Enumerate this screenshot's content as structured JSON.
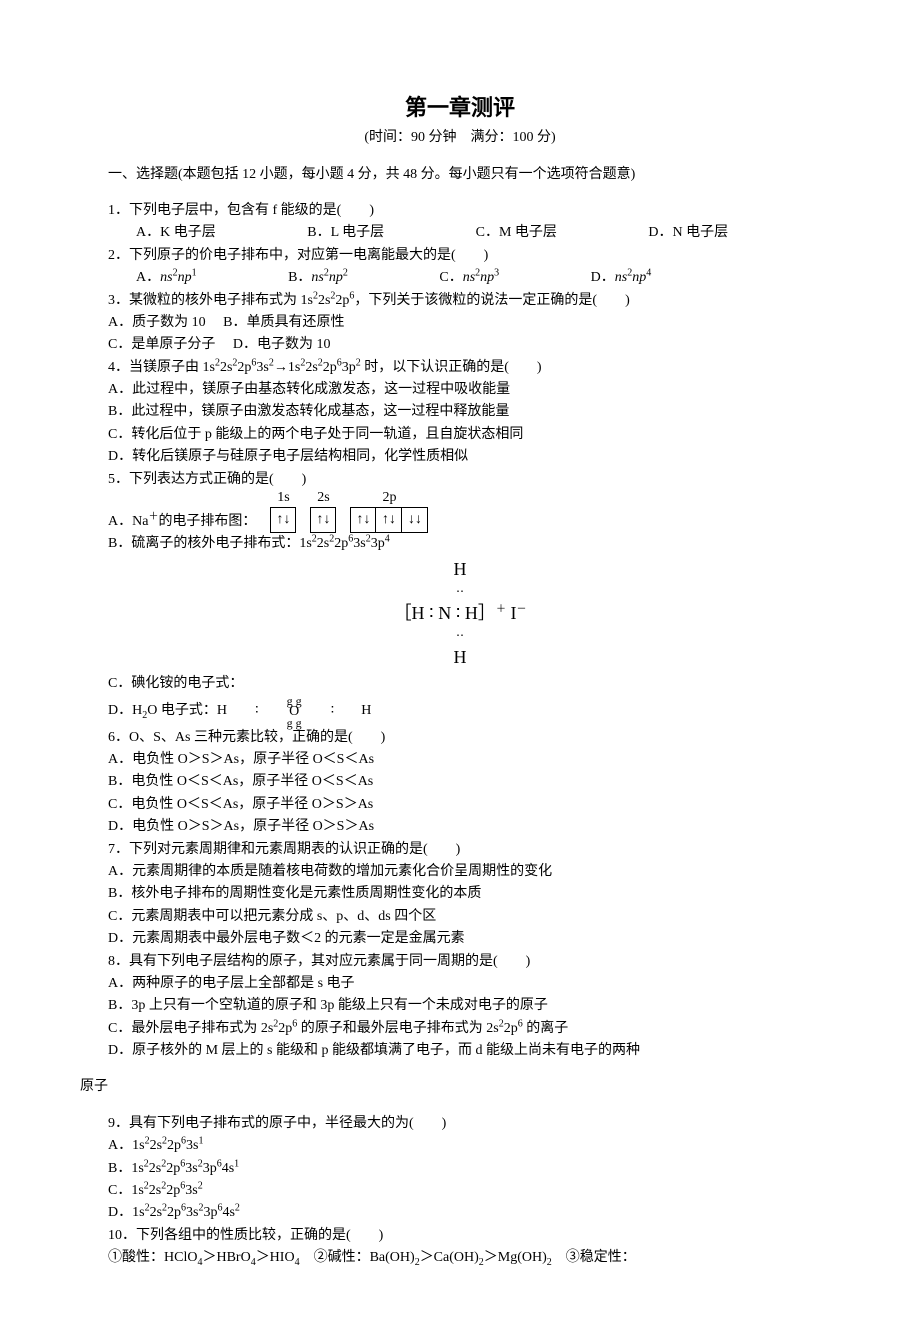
{
  "title": "第一章测评",
  "subtitle": "(时间：90 分钟　满分：100 分)",
  "section1_header": "一、选择题(本题包括 12 小题，每小题 4 分，共 48 分。每小题只有一个选项符合题意)",
  "q1": {
    "stem": "1．下列电子层中，包含有 f 能级的是(　　)",
    "A": "A．K 电子层",
    "B": "B．L 电子层",
    "C": "C．M 电子层",
    "D": "D．N 电子层"
  },
  "q2": {
    "stem": "2．下列原子的价电子排布中，对应第一电离能最大的是(　　)",
    "A_pre": "A．",
    "A_cfg": "ns",
    "A_sup1": "2",
    "A_mid": "np",
    "A_sup2": "1",
    "B_pre": "B．",
    "B_cfg": "ns",
    "B_sup1": "2",
    "B_mid": "np",
    "B_sup2": "2",
    "C_pre": "C．",
    "C_cfg": "ns",
    "C_sup1": "2",
    "C_mid": "np",
    "C_sup2": "3",
    "D_pre": "D．",
    "D_cfg": "ns",
    "D_sup1": "2",
    "D_mid": "np",
    "D_sup2": "4"
  },
  "q3": {
    "stem_pre": "3．某微粒的核外电子排布式为 1s",
    "stem_post": "，下列关于该微粒的说法一定正确的是(　　)",
    "cfg": [
      "2",
      "2s",
      "2",
      "2p",
      "6"
    ],
    "A": "A．质子数为 10",
    "B": "B．单质具有还原性",
    "C": "C．是单原子分子",
    "D": "D．电子数为 10"
  },
  "q4": {
    "stem_pre": "4．当镁原子由 1s",
    "cfg1": [
      "2",
      "2s",
      "2",
      "2p",
      "6",
      "3s",
      "2"
    ],
    "arrow": "→1s",
    "cfg2": [
      "2",
      "2s",
      "2",
      "2p",
      "6",
      "3p",
      "2"
    ],
    "stem_post": " 时，以下认识正确的是(　　)",
    "A": "A．此过程中，镁原子由基态转化成激发态，这一过程中吸收能量",
    "B": "B．此过程中，镁原子由激发态转化成基态，这一过程中释放能量",
    "C": "C．转化后位于 p 能级上的两个电子处于同一轨道，且自旋状态相同",
    "D": "D．转化后镁原子与硅原子电子层结构相同，化学性质相似"
  },
  "q5": {
    "stem": "5．下列表达方式正确的是(　　)",
    "A_pre": "A．Na",
    "A_sup": "＋",
    "A_post": "的电子排布图：",
    "labels": {
      "s1": "1s",
      "s2": "2s",
      "s2p": "2p"
    },
    "arrows": {
      "ud": "↑↓",
      "ud2": "↑↓",
      "p1": "↑↓",
      "p2": "↑↓",
      "p3": "↓↓"
    },
    "B_pre": "B．硫离子的核外电子排布式：1s",
    "B_cfg": [
      "2",
      "2s",
      "2",
      "2p",
      "6",
      "3s",
      "2",
      "3p",
      "4"
    ],
    "lewis": {
      "topH": "H",
      "line": "［H ∶ N ∶ H］",
      "sup": "＋",
      "anion": " I",
      "an_sup": "－",
      "botH": "H"
    },
    "C": "C．碘化铵的电子式：",
    "D_pre": "D．H",
    "D_sub": "2",
    "D_mid": "O 电子式：H",
    "D_colon": "∶",
    "D_O": "O",
    "D_colon2": "∶",
    "D_H2": "H",
    "gg": "g g"
  },
  "q6": {
    "stem": "6．O、S、As 三种元素比较，正确的是(　　)",
    "A": "A．电负性 O＞S＞As，原子半径 O＜S＜As",
    "B": "B．电负性 O＜S＜As，原子半径 O＜S＜As",
    "C": "C．电负性 O＜S＜As，原子半径 O＞S＞As",
    "D": "D．电负性 O＞S＞As，原子半径 O＞S＞As"
  },
  "q7": {
    "stem": "7．下列对元素周期律和元素周期表的认识正确的是(　　)",
    "A": "A．元素周期律的本质是随着核电荷数的增加元素化合价呈周期性的变化",
    "B": "B．核外电子排布的周期性变化是元素性质周期性变化的本质",
    "C": "C．元素周期表中可以把元素分成 s、p、d、ds 四个区",
    "D": "D．元素周期表中最外层电子数＜2 的元素一定是金属元素"
  },
  "q8": {
    "stem": "8．具有下列电子层结构的原子，其对应元素属于同一周期的是(　　)",
    "A": "A．两种原子的电子层上全部都是 s 电子",
    "B": "B．3p 上只有一个空轨道的原子和 3p 能级上只有一个未成对电子的原子",
    "C_pre": "C．最外层电子排布式为 2s",
    "C_sup1": "2",
    "C_mid1": "2p",
    "C_sup2": "6",
    "C_mid2": " 的原子和最外层电子排布式为 2s",
    "C_sup3": "2",
    "C_mid3": "2p",
    "C_sup4": "6",
    "C_post": " 的离子",
    "D": "D．原子核外的 M 层上的 s 能级和 p 能级都填满了电子，而 d 能级上尚未有电子的两种",
    "D2": "原子"
  },
  "q9": {
    "stem": "9．具有下列电子排布式的原子中，半径最大的为(　　)",
    "A_pre": "A．1s",
    "A_cfg": [
      "2",
      "2s",
      "2",
      "2p",
      "6",
      "3s",
      "1"
    ],
    "B_pre": "B．1s",
    "B_cfg": [
      "2",
      "2s",
      "2",
      "2p",
      "6",
      "3s",
      "2",
      "3p",
      "6",
      "4s",
      "1"
    ],
    "C_pre": "C．1s",
    "C_cfg": [
      "2",
      "2s",
      "2",
      "2p",
      "6",
      "3s",
      "2"
    ],
    "D_pre": "D．1s",
    "D_cfg": [
      "2",
      "2s",
      "2",
      "2p",
      "6",
      "3s",
      "2",
      "3p",
      "6",
      "4s",
      "2"
    ]
  },
  "q10": {
    "stem": "10．下列各组中的性质比较，正确的是(　　)",
    "line1_a": "①酸性：HClO",
    "s4a": "4",
    "gt1": "＞HBrO",
    "s4b": "4",
    "gt2": "＞HIO",
    "s4c": "4",
    "line1_b": "　②碱性：Ba(OH)",
    "s2a": "2",
    "gt3": "＞Ca(OH)",
    "s2b": "2",
    "gt4": "＞Mg(OH)",
    "s2c": "2",
    "line1_c": "　③稳定性："
  }
}
